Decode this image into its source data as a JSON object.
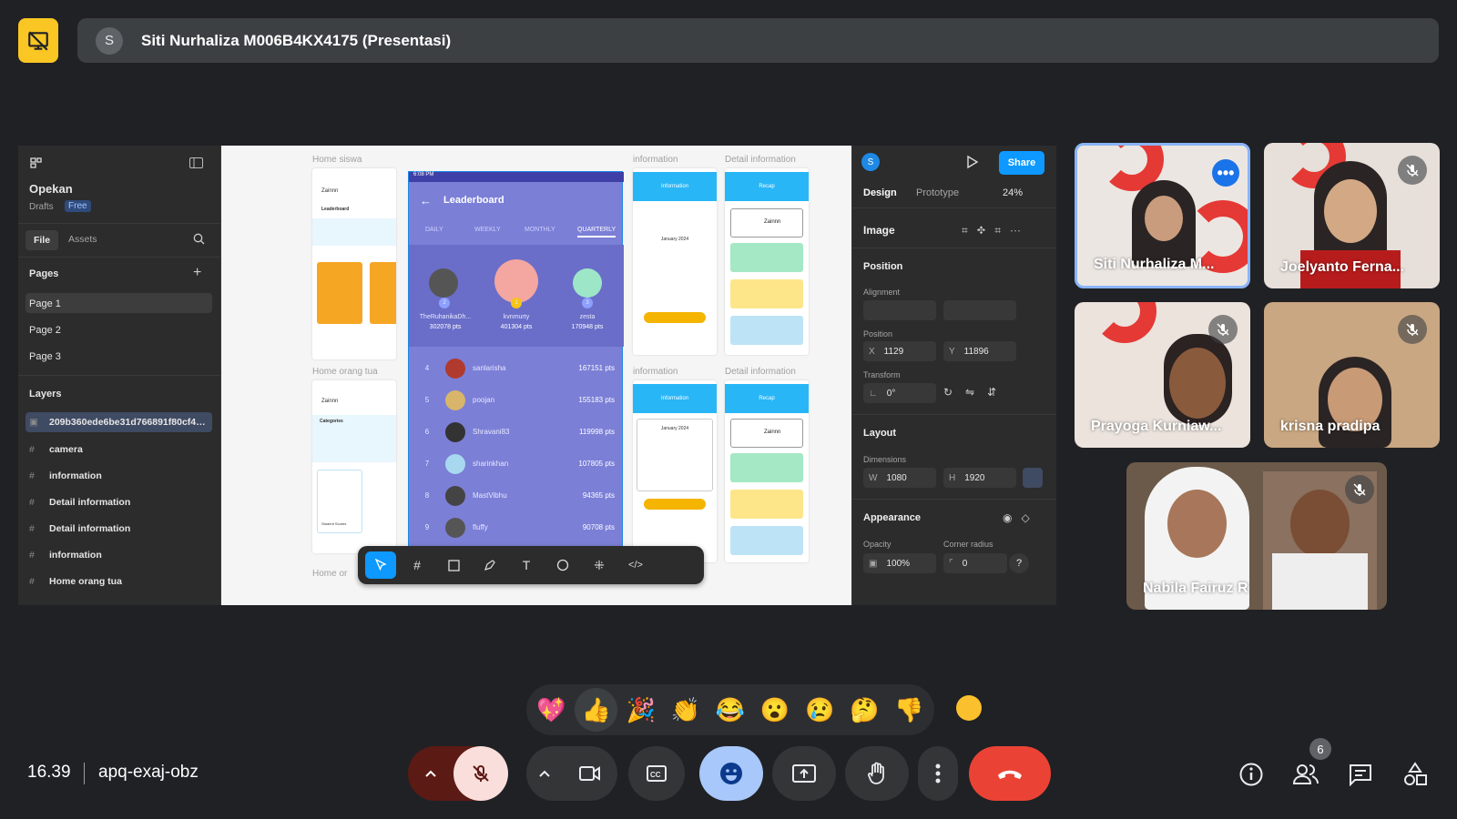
{
  "presenter": {
    "avatar_initial": "S",
    "title": "Siti Nurhaliza M006B4KX4175 (Presentasi)"
  },
  "figma": {
    "file_name": "Opekan",
    "drafts": "Drafts",
    "plan_badge": "Free",
    "tabs": [
      "File",
      "Assets"
    ],
    "pages_label": "Pages",
    "pages": [
      "Page 1",
      "Page 2",
      "Page 3"
    ],
    "layers_label": "Layers",
    "layers": [
      "209b360ede6be31d766891f80cf4…",
      "camera",
      "information",
      "Detail information",
      "Detail information",
      "information",
      "Home orang tua"
    ],
    "canvas": {
      "labels": [
        "Home siswa",
        "information",
        "Detail information",
        "Home orang tua",
        "information",
        "Detail information",
        "Home or"
      ],
      "leaderboard": {
        "title": "Leaderboard",
        "status_time": "6:08 PM",
        "tabs": [
          "DAILY",
          "WEEKLY",
          "MONTHLY",
          "QUARTERLY"
        ],
        "podium": [
          {
            "name": "TheRuhanikaDh...",
            "pts": "302078 pts",
            "rank": "2"
          },
          {
            "name": "kvnmurty",
            "pts": "401304 pts",
            "rank": "1"
          },
          {
            "name": "zesta",
            "pts": "170948 pts",
            "rank": "3"
          }
        ],
        "rows": [
          {
            "rank": "4",
            "name": "sanlarisha",
            "pts": "167151 pts"
          },
          {
            "rank": "5",
            "name": "poojan",
            "pts": "155183 pts"
          },
          {
            "rank": "6",
            "name": "Shravani83",
            "pts": "119998 pts"
          },
          {
            "rank": "7",
            "name": "sharinkhan",
            "pts": "107805 pts"
          },
          {
            "rank": "8",
            "name": "MastVibhu",
            "pts": "94365 pts"
          },
          {
            "rank": "9",
            "name": "fluffy",
            "pts": "90708 pts"
          }
        ]
      },
      "phone_user": "Zainnn",
      "phone_section": "Leaderboard",
      "categories_label": "Categories",
      "calendar_month": "January 2024",
      "info_header": "Information",
      "recap_header": "Recap",
      "student_scores": "Student Scores"
    },
    "right_panel": {
      "user_initial": "S",
      "share": "Share",
      "tabs": [
        "Design",
        "Prototype"
      ],
      "zoom": "24%",
      "selection": "Image",
      "position_section": "Position",
      "alignment_label": "Alignment",
      "position_label": "Position",
      "x_key": "X",
      "x_val": "1129",
      "y_key": "Y",
      "y_val": "11896",
      "transform_label": "Transform",
      "rotation": "0°",
      "layout_section": "Layout",
      "dimensions_label": "Dimensions",
      "w_key": "W",
      "w_val": "1080",
      "h_key": "H",
      "h_val": "1920",
      "appearance_section": "Appearance",
      "opacity_label": "Opacity",
      "opacity_val": "100%",
      "corner_label": "Corner radius",
      "corner_val": "0",
      "help": "?"
    }
  },
  "participants": [
    {
      "name": "Siti Nurhaliza M...",
      "muted": false,
      "active": true
    },
    {
      "name": "Joelyanto Ferna...",
      "muted": true
    },
    {
      "name": "Prayoga Kurniaw...",
      "muted": true
    },
    {
      "name": "krisna pradipa",
      "muted": true
    },
    {
      "name": "Nabila Fairuz R",
      "muted": true
    }
  ],
  "reactions": [
    "💖",
    "👍",
    "🎉",
    "👏",
    "😂",
    "😮",
    "😢",
    "🤔",
    "👎"
  ],
  "bottom": {
    "time": "16.39",
    "meeting_code": "apq-exaj-obz",
    "people_count": "6"
  },
  "colors": {
    "background": "#202124",
    "accent_yellow": "#f9c623",
    "end_call": "#ea4335",
    "mic_off": "#f9dedc",
    "active_blue": "#a8c7fa",
    "figma_blue": "#0d99ff"
  }
}
